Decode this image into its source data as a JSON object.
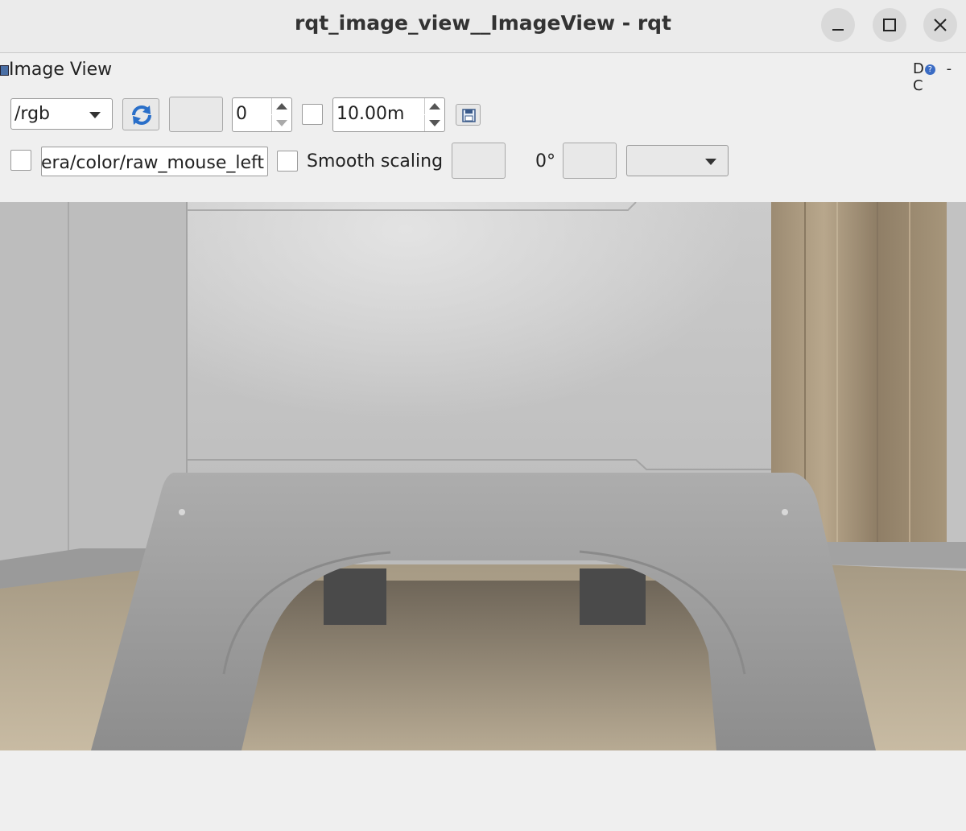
{
  "window": {
    "title": "rqt_image_view__ImageView - rqt",
    "minimize_icon": "minimize-icon",
    "maximize_icon": "maximize-icon",
    "close_icon": "close-icon"
  },
  "panel": {
    "title": "Image View",
    "right_label": "D",
    "help_glyph": "?",
    "right_extra": "- C"
  },
  "toolbar": {
    "topic_selected": "/rgb",
    "refresh_icon": "refresh-icon",
    "spin_value": "0",
    "range_value": "10.00m",
    "save_icon": "save-icon"
  },
  "row2": {
    "mouse_topic_value": "nera/color/raw_mouse_left",
    "smooth_scaling_label": "Smooth scaling",
    "rotation_label": "0°"
  }
}
